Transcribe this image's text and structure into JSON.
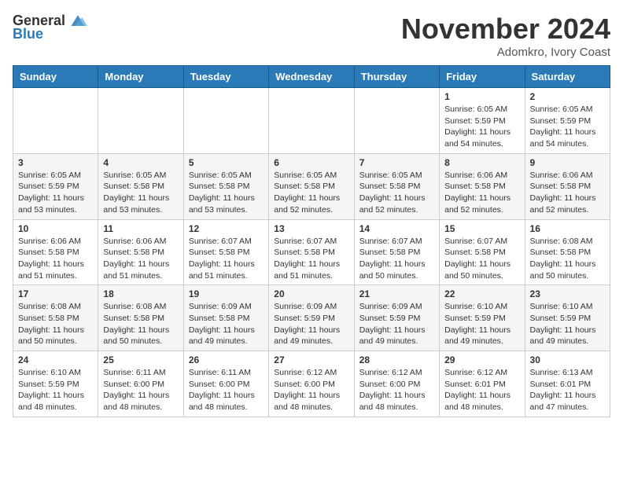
{
  "header": {
    "logo_general": "General",
    "logo_blue": "Blue",
    "month_title": "November 2024",
    "location": "Adomkro, Ivory Coast"
  },
  "calendar": {
    "days_of_week": [
      "Sunday",
      "Monday",
      "Tuesday",
      "Wednesday",
      "Thursday",
      "Friday",
      "Saturday"
    ],
    "weeks": [
      [
        {
          "day": "",
          "info": ""
        },
        {
          "day": "",
          "info": ""
        },
        {
          "day": "",
          "info": ""
        },
        {
          "day": "",
          "info": ""
        },
        {
          "day": "",
          "info": ""
        },
        {
          "day": "1",
          "info": "Sunrise: 6:05 AM\nSunset: 5:59 PM\nDaylight: 11 hours\nand 54 minutes."
        },
        {
          "day": "2",
          "info": "Sunrise: 6:05 AM\nSunset: 5:59 PM\nDaylight: 11 hours\nand 54 minutes."
        }
      ],
      [
        {
          "day": "3",
          "info": "Sunrise: 6:05 AM\nSunset: 5:59 PM\nDaylight: 11 hours\nand 53 minutes."
        },
        {
          "day": "4",
          "info": "Sunrise: 6:05 AM\nSunset: 5:58 PM\nDaylight: 11 hours\nand 53 minutes."
        },
        {
          "day": "5",
          "info": "Sunrise: 6:05 AM\nSunset: 5:58 PM\nDaylight: 11 hours\nand 53 minutes."
        },
        {
          "day": "6",
          "info": "Sunrise: 6:05 AM\nSunset: 5:58 PM\nDaylight: 11 hours\nand 52 minutes."
        },
        {
          "day": "7",
          "info": "Sunrise: 6:05 AM\nSunset: 5:58 PM\nDaylight: 11 hours\nand 52 minutes."
        },
        {
          "day": "8",
          "info": "Sunrise: 6:06 AM\nSunset: 5:58 PM\nDaylight: 11 hours\nand 52 minutes."
        },
        {
          "day": "9",
          "info": "Sunrise: 6:06 AM\nSunset: 5:58 PM\nDaylight: 11 hours\nand 52 minutes."
        }
      ],
      [
        {
          "day": "10",
          "info": "Sunrise: 6:06 AM\nSunset: 5:58 PM\nDaylight: 11 hours\nand 51 minutes."
        },
        {
          "day": "11",
          "info": "Sunrise: 6:06 AM\nSunset: 5:58 PM\nDaylight: 11 hours\nand 51 minutes."
        },
        {
          "day": "12",
          "info": "Sunrise: 6:07 AM\nSunset: 5:58 PM\nDaylight: 11 hours\nand 51 minutes."
        },
        {
          "day": "13",
          "info": "Sunrise: 6:07 AM\nSunset: 5:58 PM\nDaylight: 11 hours\nand 51 minutes."
        },
        {
          "day": "14",
          "info": "Sunrise: 6:07 AM\nSunset: 5:58 PM\nDaylight: 11 hours\nand 50 minutes."
        },
        {
          "day": "15",
          "info": "Sunrise: 6:07 AM\nSunset: 5:58 PM\nDaylight: 11 hours\nand 50 minutes."
        },
        {
          "day": "16",
          "info": "Sunrise: 6:08 AM\nSunset: 5:58 PM\nDaylight: 11 hours\nand 50 minutes."
        }
      ],
      [
        {
          "day": "17",
          "info": "Sunrise: 6:08 AM\nSunset: 5:58 PM\nDaylight: 11 hours\nand 50 minutes."
        },
        {
          "day": "18",
          "info": "Sunrise: 6:08 AM\nSunset: 5:58 PM\nDaylight: 11 hours\nand 50 minutes."
        },
        {
          "day": "19",
          "info": "Sunrise: 6:09 AM\nSunset: 5:58 PM\nDaylight: 11 hours\nand 49 minutes."
        },
        {
          "day": "20",
          "info": "Sunrise: 6:09 AM\nSunset: 5:59 PM\nDaylight: 11 hours\nand 49 minutes."
        },
        {
          "day": "21",
          "info": "Sunrise: 6:09 AM\nSunset: 5:59 PM\nDaylight: 11 hours\nand 49 minutes."
        },
        {
          "day": "22",
          "info": "Sunrise: 6:10 AM\nSunset: 5:59 PM\nDaylight: 11 hours\nand 49 minutes."
        },
        {
          "day": "23",
          "info": "Sunrise: 6:10 AM\nSunset: 5:59 PM\nDaylight: 11 hours\nand 49 minutes."
        }
      ],
      [
        {
          "day": "24",
          "info": "Sunrise: 6:10 AM\nSunset: 5:59 PM\nDaylight: 11 hours\nand 48 minutes."
        },
        {
          "day": "25",
          "info": "Sunrise: 6:11 AM\nSunset: 6:00 PM\nDaylight: 11 hours\nand 48 minutes."
        },
        {
          "day": "26",
          "info": "Sunrise: 6:11 AM\nSunset: 6:00 PM\nDaylight: 11 hours\nand 48 minutes."
        },
        {
          "day": "27",
          "info": "Sunrise: 6:12 AM\nSunset: 6:00 PM\nDaylight: 11 hours\nand 48 minutes."
        },
        {
          "day": "28",
          "info": "Sunrise: 6:12 AM\nSunset: 6:00 PM\nDaylight: 11 hours\nand 48 minutes."
        },
        {
          "day": "29",
          "info": "Sunrise: 6:12 AM\nSunset: 6:01 PM\nDaylight: 11 hours\nand 48 minutes."
        },
        {
          "day": "30",
          "info": "Sunrise: 6:13 AM\nSunset: 6:01 PM\nDaylight: 11 hours\nand 47 minutes."
        }
      ]
    ]
  }
}
